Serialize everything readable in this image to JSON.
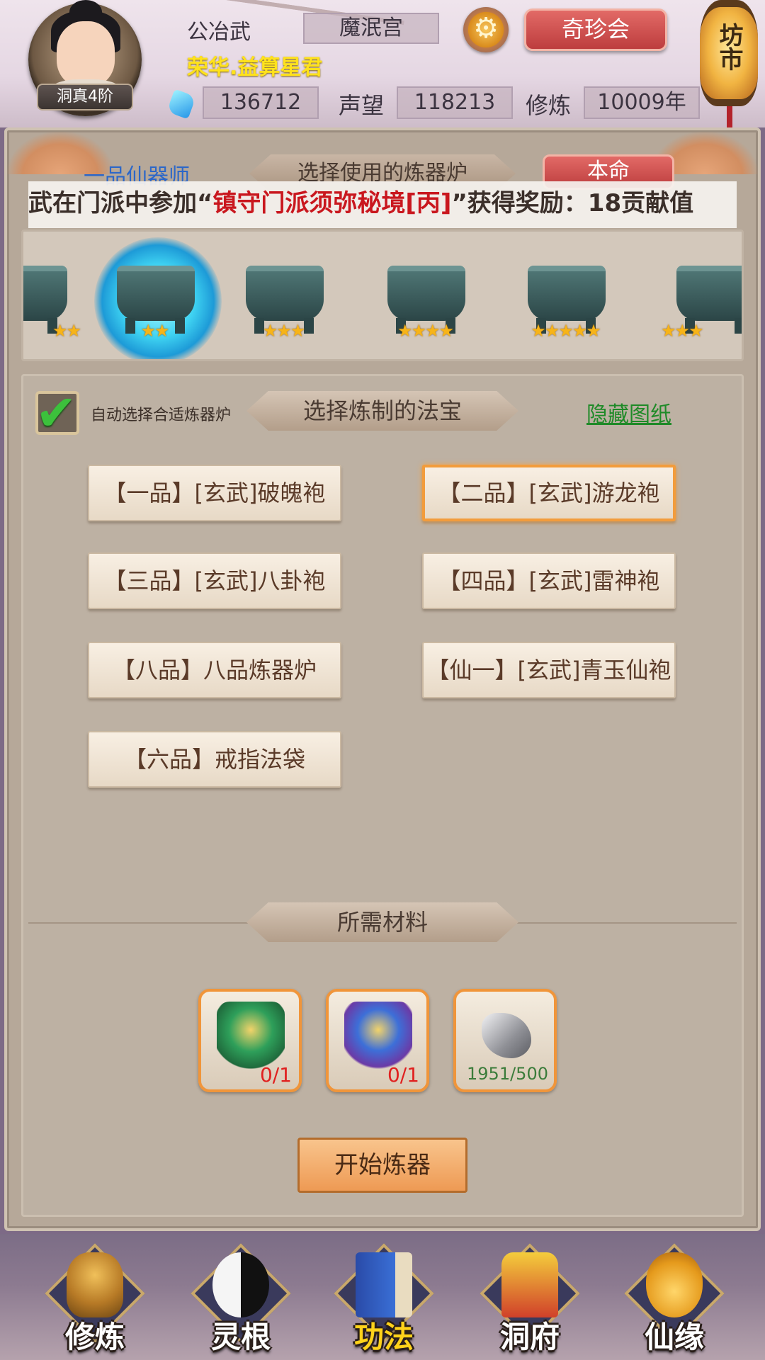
{
  "header": {
    "rank": "洞真4阶",
    "player_name": "公冶武",
    "player_title": "荣华.益算星君",
    "sect": "魔泯宫",
    "treasure_button": "奇珍会",
    "market_label": "坊市",
    "spirit_stones": "136712",
    "reputation_label": "声望",
    "reputation": "118213",
    "cultivation_label": "修炼",
    "cultivation": "10009年"
  },
  "furnace": {
    "grade_label": "一品仙器师",
    "title": "选择使用的炼器炉",
    "benming_button": "本命",
    "broadcast_prefix": "武在门派中参加“",
    "broadcast_highlight": "镇守门派须弥秘境[丙]",
    "broadcast_suffix": "”获得奖励：18贡献值",
    "items": [
      {
        "stars": "★★"
      },
      {
        "stars": "★★"
      },
      {
        "stars": "★★★"
      },
      {
        "stars": "★★★★"
      },
      {
        "stars": "★★★★★"
      },
      {
        "stars": "★★★"
      }
    ]
  },
  "recipes": {
    "auto_label": "自动选择合适炼器炉",
    "title": "选择炼制的法宝",
    "hide_link": "隐藏图纸",
    "items": [
      {
        "label": "【一品】[玄武]破魄袍"
      },
      {
        "label": "【二品】[玄武]游龙袍"
      },
      {
        "label": "【三品】[玄武]八卦袍"
      },
      {
        "label": "【四品】[玄武]雷神袍"
      },
      {
        "label": "【八品】八品炼器炉"
      },
      {
        "label": "【仙一】[玄武]青玉仙袍"
      },
      {
        "label": "【六品】戒指法袋"
      }
    ],
    "selected_index": 1
  },
  "materials": {
    "title": "所需材料",
    "items": [
      {
        "icon": "green-armor-icon",
        "count": "0/1"
      },
      {
        "icon": "blue-robe-icon",
        "count": "0/1"
      },
      {
        "icon": "silver-ore-icon",
        "count": "1951/500"
      }
    ],
    "start_button": "开始炼器"
  },
  "nav": {
    "items": [
      {
        "label": "修炼",
        "icon": "meditating-figure-icon"
      },
      {
        "label": "灵根",
        "icon": "yin-yang-sword-icon"
      },
      {
        "label": "功法",
        "icon": "book-icon"
      },
      {
        "label": "洞府",
        "icon": "pagoda-icon"
      },
      {
        "label": "仙缘",
        "icon": "gourd-icon"
      }
    ],
    "active": "功法"
  },
  "colors": {
    "accent_red": "#bd3d3e",
    "highlight_yellow": "#ffe21c",
    "selected_border": "#f29c3c",
    "link_green": "#1f8a28",
    "need_red": "#e0201f"
  }
}
